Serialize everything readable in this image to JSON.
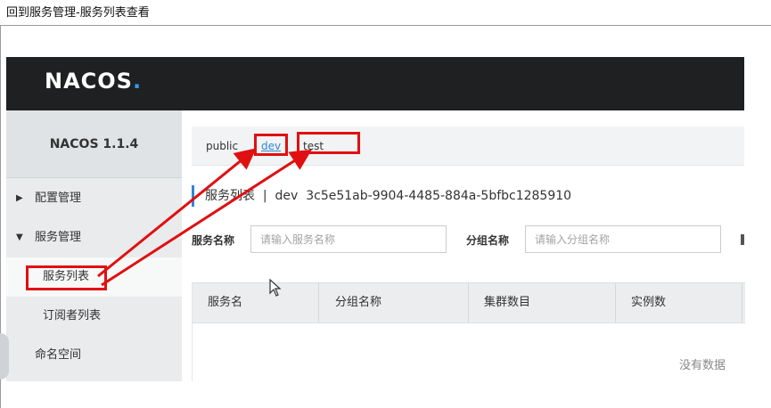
{
  "window": {
    "title": "回到服务管理-服务列表查看"
  },
  "header": {
    "logo_text": "NACOS",
    "logo_dot": "."
  },
  "sidebar": {
    "version": "NACOS 1.1.4",
    "items": [
      {
        "label": "配置管理",
        "expanded": false
      },
      {
        "label": "服务管理",
        "expanded": true
      },
      {
        "label": "服务列表",
        "active": true
      },
      {
        "label": "订阅者列表"
      },
      {
        "label": "命名空间"
      }
    ]
  },
  "namespaces": {
    "items": [
      "public",
      "dev",
      "test"
    ],
    "active": "dev"
  },
  "page": {
    "title": "服务列表",
    "separator": "|",
    "namespace_name": "dev",
    "namespace_id": "3c5e51ab-9904-4485-884a-5bfbc1285910"
  },
  "filters": {
    "service_name_label": "服务名称",
    "service_name_placeholder": "请输入服务名称",
    "group_name_label": "分组名称",
    "group_name_placeholder": "请输入分组名称"
  },
  "table": {
    "columns": [
      "服务名",
      "分组名称",
      "集群数目",
      "实例数"
    ],
    "empty_text": "没有数据"
  },
  "colors": {
    "header_bg": "#1e2022",
    "sidebar_bg": "#e9ebec",
    "accent": "#2f86d6",
    "annotation": "#e01010"
  },
  "icons": {
    "expand_collapsed": "caret-right-icon",
    "expand_open": "caret-down-icon",
    "cursor": "mouse-cursor-icon"
  }
}
